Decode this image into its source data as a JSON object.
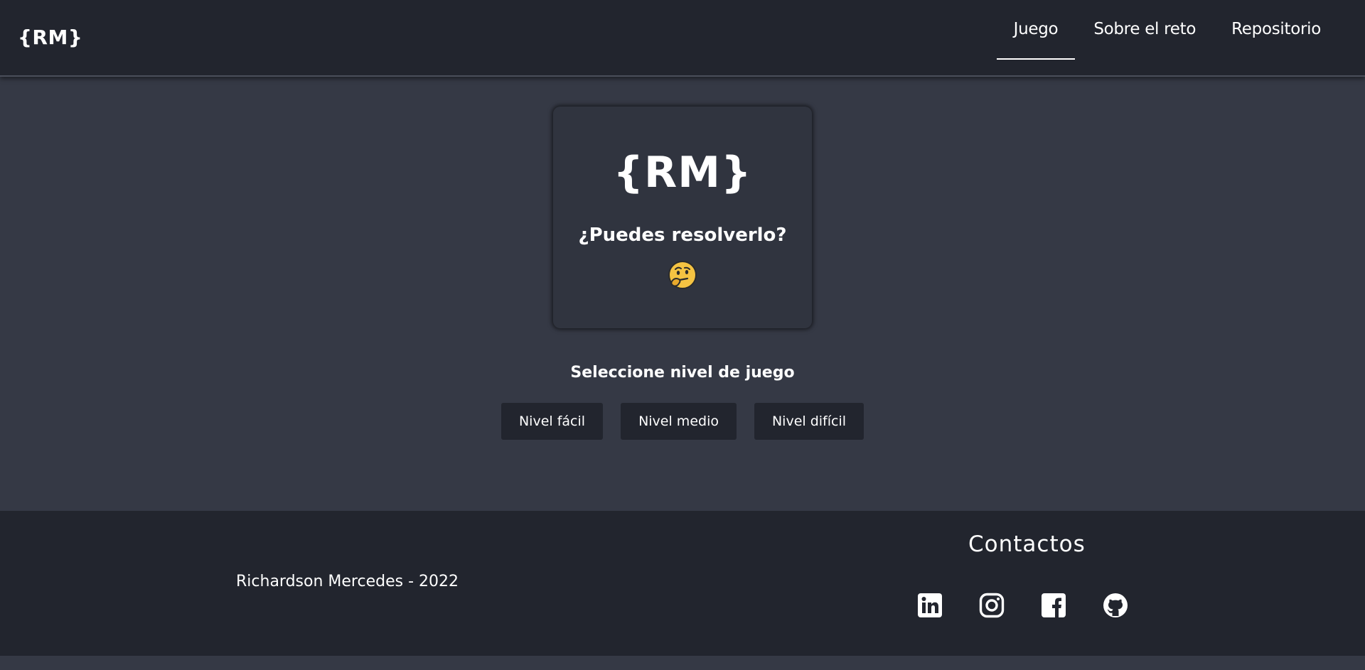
{
  "navbar": {
    "brand": "{RM}",
    "links": [
      {
        "label": "Juego",
        "active": true
      },
      {
        "label": "Sobre el reto",
        "active": false
      },
      {
        "label": "Repositorio",
        "active": false
      }
    ]
  },
  "hero": {
    "logo": "{RM}",
    "question": "¿Puedes resolverlo?",
    "emoji_icon": "thinking-face-icon"
  },
  "levels": {
    "title": "Seleccione nivel de juego",
    "buttons": [
      "Nivel fácil",
      "Nivel medio",
      "Nivel difícil"
    ]
  },
  "footer": {
    "copyright": "Richardson Mercedes - 2022",
    "contacts_title": "Contactos",
    "socials": [
      "linkedin-icon",
      "instagram-icon",
      "facebook-icon",
      "github-icon"
    ]
  },
  "colors": {
    "background": "#353945",
    "navbar": "#22252e",
    "card": "#30343f",
    "button": "#22252e",
    "text": "#ffffff",
    "emoji": "#f5c342"
  }
}
